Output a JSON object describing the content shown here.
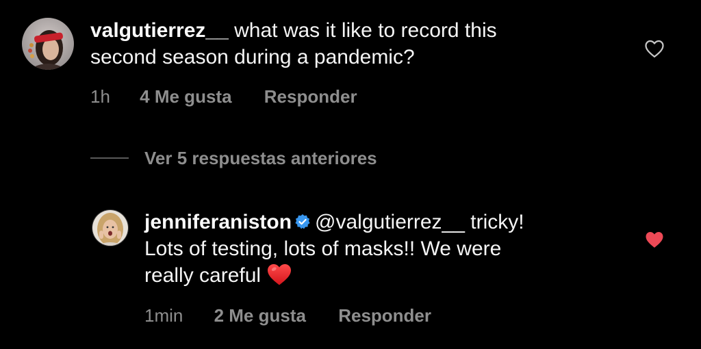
{
  "comment": {
    "username": "valgutierrez__",
    "text_line1": "what was it like to record this",
    "text_line2": "second season during a pandemic?",
    "time": "1h",
    "likes": "4 Me gusta",
    "reply_label": "Responder",
    "liked": false
  },
  "view_replies": {
    "label": "Ver 5 respuestas anteriores"
  },
  "reply": {
    "username": "jenniferaniston",
    "verified": true,
    "mention": "@valgutierrez__",
    "text_line1_rest": " tricky!",
    "text_line2": "Lots of testing, lots of masks!! We were",
    "text_line3": "really careful",
    "emoji": "heart-emoji",
    "time": "1min",
    "likes": "2 Me gusta",
    "reply_label": "Responder",
    "liked": true
  },
  "colors": {
    "background": "#000000",
    "text": "#f5f5f5",
    "meta": "#8e8e8e",
    "liked_heart": "#ed4956",
    "verified_badge": "#3897f0"
  },
  "icons": {
    "like_outline": "heart-outline-icon",
    "like_filled": "heart-filled-icon",
    "verified": "verified-badge-icon"
  }
}
